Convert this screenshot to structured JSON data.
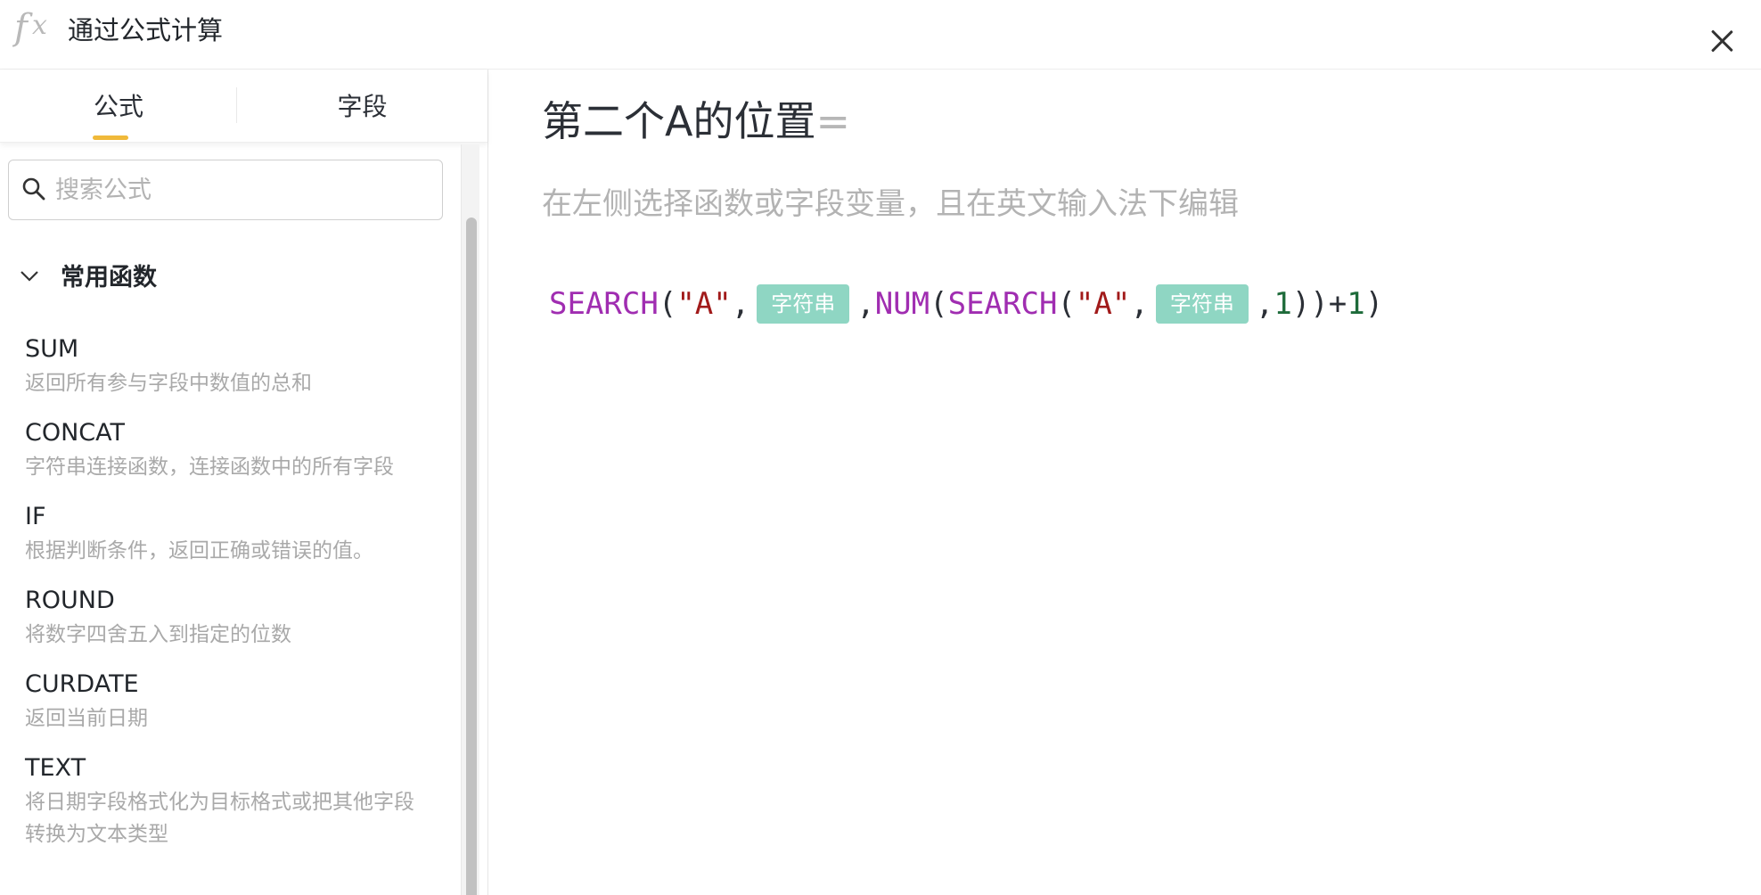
{
  "header": {
    "logo_text": "fx",
    "title": "通过公式计算",
    "close_icon": "close-icon"
  },
  "tabs": [
    {
      "label": "公式",
      "active": true
    },
    {
      "label": "字段",
      "active": false
    }
  ],
  "colors": {
    "accent": "#f0b93a",
    "chip_background": "#8fd6c3",
    "function_token": "#a02db1",
    "string_token": "#a11a1a",
    "number_token": "#1e6b3a"
  },
  "search": {
    "placeholder": "搜索公式",
    "value": "",
    "icon": "search-icon"
  },
  "section": {
    "title": "常用函数",
    "icon": "chevron-down-icon",
    "expanded": true
  },
  "functions": [
    {
      "name": "SUM",
      "desc": "返回所有参与字段中数值的总和"
    },
    {
      "name": "CONCAT",
      "desc": "字符串连接函数，连接函数中的所有字段"
    },
    {
      "name": "IF",
      "desc": "根据判断条件，返回正确或错误的值。"
    },
    {
      "name": "ROUND",
      "desc": "将数字四舍五入到指定的位数"
    },
    {
      "name": "CURDATE",
      "desc": "返回当前日期"
    },
    {
      "name": "TEXT",
      "desc": "将日期字段格式化为目标格式或把其他字段转换为文本类型"
    }
  ],
  "editor": {
    "field_name": "第二个A的位置",
    "equals": "=",
    "hint": "在左侧选择函数或字段变量，且在英文输入法下编辑",
    "formula_tokens": [
      {
        "type": "func",
        "text": "SEARCH"
      },
      {
        "type": "paren",
        "text": "("
      },
      {
        "type": "str",
        "text": "\"A\""
      },
      {
        "type": "comma",
        "text": ","
      },
      {
        "type": "chip",
        "text": "字符串"
      },
      {
        "type": "comma",
        "text": ","
      },
      {
        "type": "func",
        "text": "NUM"
      },
      {
        "type": "paren",
        "text": "("
      },
      {
        "type": "func",
        "text": "SEARCH"
      },
      {
        "type": "paren",
        "text": "("
      },
      {
        "type": "str",
        "text": "\"A\""
      },
      {
        "type": "comma",
        "text": ","
      },
      {
        "type": "chip",
        "text": "字符串"
      },
      {
        "type": "comma",
        "text": ","
      },
      {
        "type": "num",
        "text": "1"
      },
      {
        "type": "paren",
        "text": ")"
      },
      {
        "type": "paren",
        "text": ")"
      },
      {
        "type": "op",
        "text": "+"
      },
      {
        "type": "num",
        "text": "1"
      },
      {
        "type": "paren",
        "text": ")"
      }
    ]
  }
}
